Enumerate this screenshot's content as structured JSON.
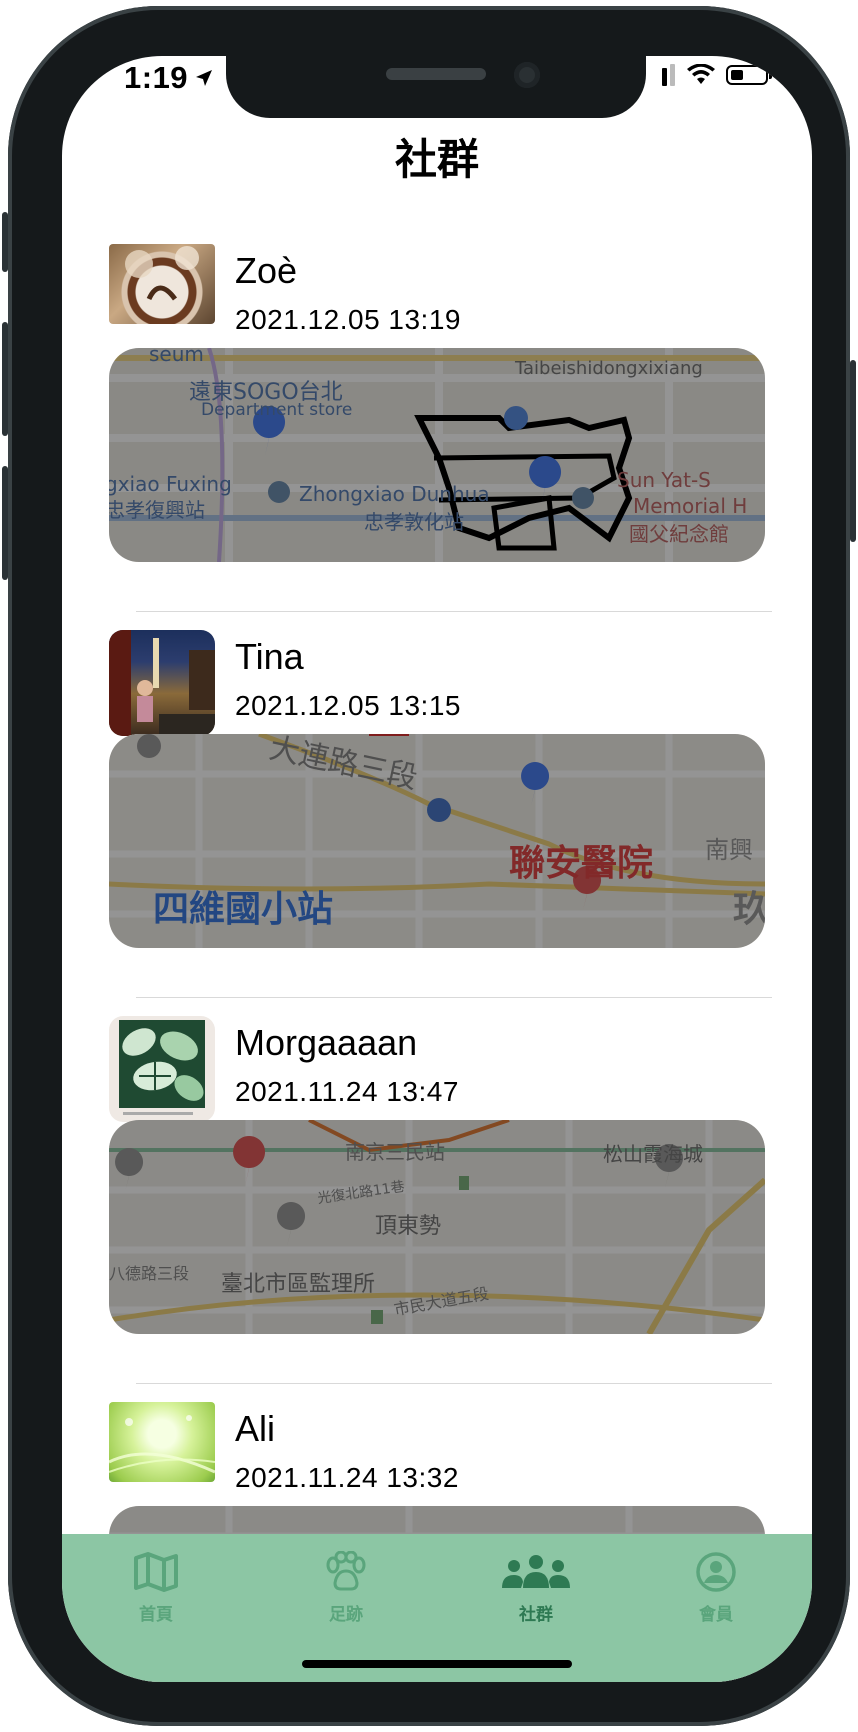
{
  "status_bar": {
    "time": "1:19"
  },
  "header": {
    "title": "社群"
  },
  "posts": [
    {
      "name": "Zoè",
      "date": "2021.12.05 13:19",
      "map_labels": [
        "seum",
        "遠東SOGO台北",
        "Department store",
        "Taibeishidongxixiang",
        "gxiao Fuxing",
        "忠孝復興站",
        "Zhongxiao Dunhua",
        "忠孝敦化站",
        "Sun Yat-S",
        "Memorial H",
        "國父紀念館"
      ]
    },
    {
      "name": "Tina",
      "date": "2021.12.05 13:15",
      "map_labels": [
        "大連路三段",
        "聯安醫院",
        "南興",
        "四維國小站",
        "玖"
      ]
    },
    {
      "name": "Morgaaaan",
      "date": "2021.11.24 13:47",
      "map_labels": [
        "南京三民站",
        "松山霞海城",
        "光復北路11巷",
        "頂東勢",
        "八德路三段",
        "臺北市區監理所",
        "市民大道五段"
      ]
    },
    {
      "name": "Ali",
      "date": "2021.11.24 13:32"
    }
  ],
  "tabs": [
    {
      "label": "首頁",
      "icon": "map-icon"
    },
    {
      "label": "足跡",
      "icon": "paw-icon"
    },
    {
      "label": "社群",
      "icon": "group-icon"
    },
    {
      "label": "會員",
      "icon": "person-circle-icon"
    }
  ],
  "colors": {
    "tab_bar": "#8cc6a4",
    "tab_inactive": "#5aa57c",
    "tab_active": "#2e7a53"
  }
}
